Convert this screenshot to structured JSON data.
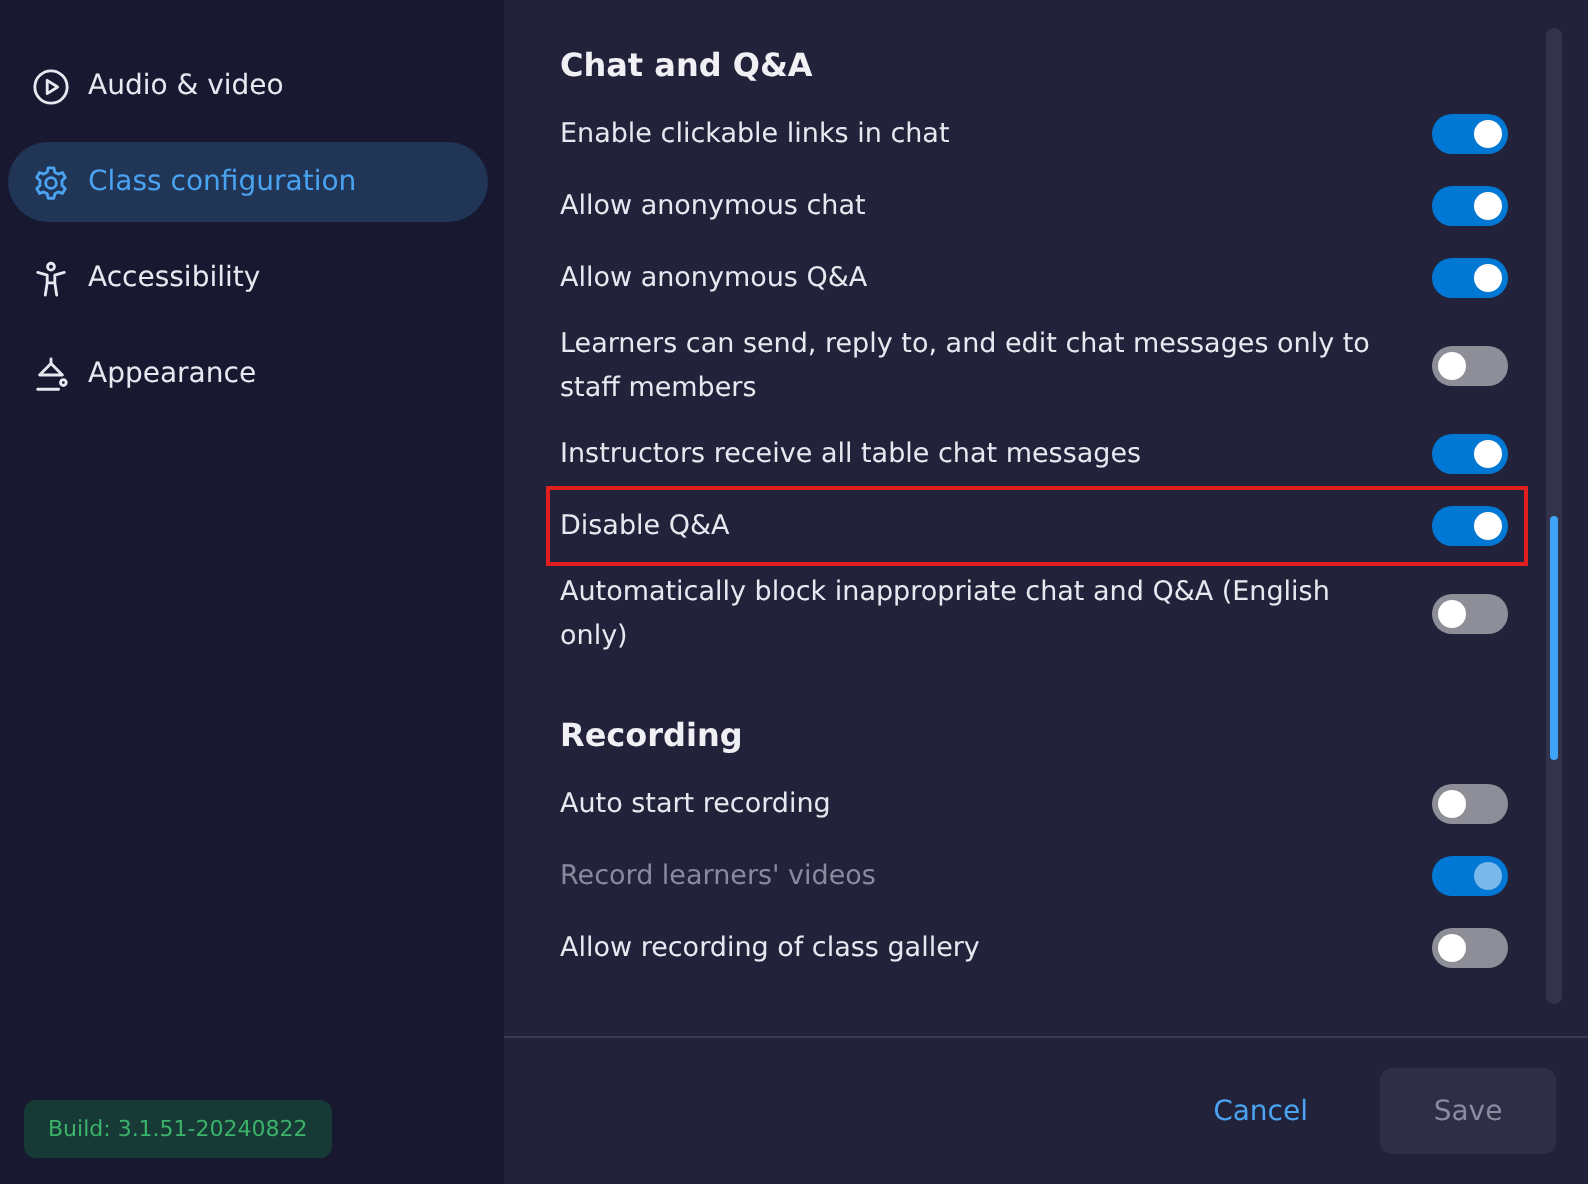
{
  "sidebar": {
    "items": [
      {
        "label": "Audio & video",
        "selected": false
      },
      {
        "label": "Class configuration",
        "selected": true
      },
      {
        "label": "Accessibility",
        "selected": false
      },
      {
        "label": "Appearance",
        "selected": false
      }
    ],
    "build": "Build: 3.1.51-20240822"
  },
  "sections": [
    {
      "title": "Chat and Q&A",
      "settings": [
        {
          "label": "Enable clickable links in chat",
          "on": true,
          "disabled": false,
          "highlighted": false
        },
        {
          "label": "Allow anonymous chat",
          "on": true,
          "disabled": false,
          "highlighted": false
        },
        {
          "label": "Allow anonymous Q&A",
          "on": true,
          "disabled": false,
          "highlighted": false
        },
        {
          "label": "Learners can send, reply to, and edit chat messages only to staff members",
          "on": false,
          "disabled": false,
          "highlighted": false
        },
        {
          "label": "Instructors receive all table chat messages",
          "on": true,
          "disabled": false,
          "highlighted": false
        },
        {
          "label": "Disable Q&A",
          "on": true,
          "disabled": false,
          "highlighted": true
        },
        {
          "label": "Automatically block inappropriate chat and Q&A (English only)",
          "on": false,
          "disabled": false,
          "highlighted": false
        }
      ]
    },
    {
      "title": "Recording",
      "settings": [
        {
          "label": "Auto start recording",
          "on": false,
          "disabled": false,
          "highlighted": false
        },
        {
          "label": "Record learners' videos",
          "on": true,
          "disabled": true,
          "highlighted": false
        },
        {
          "label": "Allow recording of class gallery",
          "on": false,
          "disabled": false,
          "highlighted": false
        }
      ]
    }
  ],
  "footer": {
    "cancel": "Cancel",
    "save": {
      "label": "Save",
      "disabled": true
    }
  }
}
